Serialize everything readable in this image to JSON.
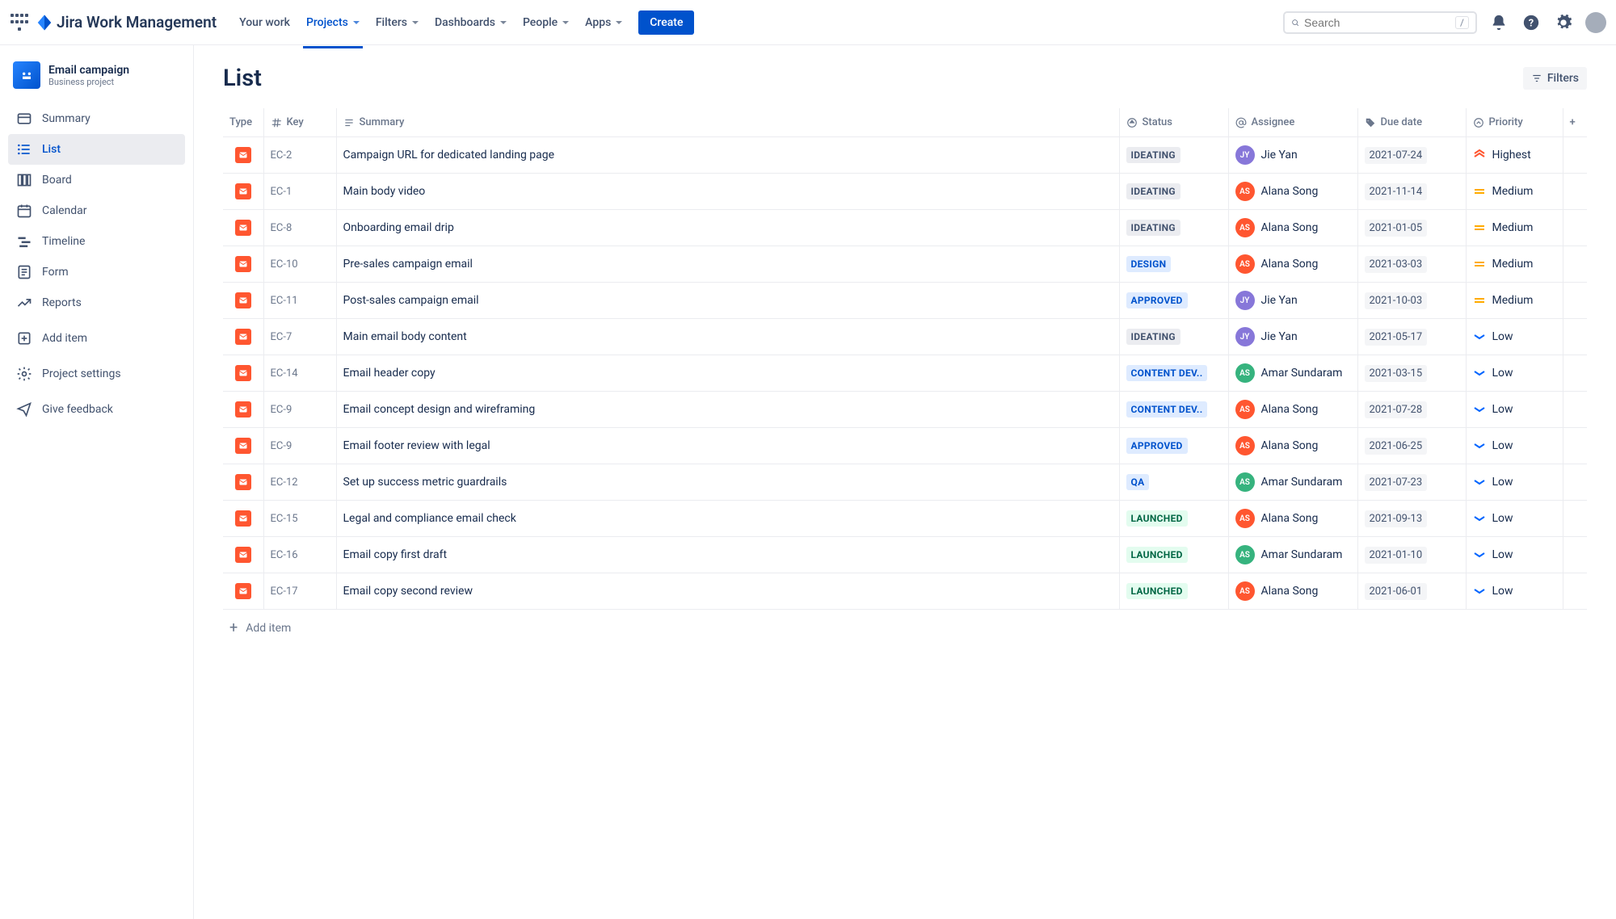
{
  "nav": {
    "product": "Jira Work Management",
    "items": [
      "Your work",
      "Projects",
      "Filters",
      "Dashboards",
      "People",
      "Apps"
    ],
    "active_index": 1,
    "create": "Create",
    "search_placeholder": "Search",
    "search_key": "/"
  },
  "sidebar": {
    "project_name": "Email campaign",
    "project_type": "Business project",
    "items": [
      {
        "icon": "summary",
        "label": "Summary"
      },
      {
        "icon": "list",
        "label": "List"
      },
      {
        "icon": "board",
        "label": "Board"
      },
      {
        "icon": "calendar",
        "label": "Calendar"
      },
      {
        "icon": "timeline",
        "label": "Timeline"
      },
      {
        "icon": "form",
        "label": "Form"
      },
      {
        "icon": "reports",
        "label": "Reports"
      },
      {
        "icon": "add",
        "label": "Add item"
      },
      {
        "icon": "settings",
        "label": "Project settings"
      },
      {
        "icon": "feedback",
        "label": "Give feedback"
      }
    ],
    "active_index": 1
  },
  "main": {
    "title": "List",
    "filters_label": "Filters",
    "add_item": "Add item",
    "columns": {
      "type": "Type",
      "key": "Key",
      "summary": "Summary",
      "status": "Status",
      "assignee": "Assignee",
      "due_date": "Due date",
      "priority": "Priority"
    },
    "rows": [
      {
        "key": "EC-2",
        "summary": "Campaign URL for dedicated landing page",
        "status": "IDEATING",
        "status_style": "gray",
        "assignee": "Jie Yan",
        "avatar_color": "#8777D9",
        "due": "2021-07-24",
        "priority": "Highest"
      },
      {
        "key": "EC-1",
        "summary": "Main body video",
        "status": "IDEATING",
        "status_style": "gray",
        "assignee": "Alana Song",
        "avatar_color": "#FF5630",
        "due": "2021-11-14",
        "priority": "Medium"
      },
      {
        "key": "EC-8",
        "summary": "Onboarding email drip",
        "status": "IDEATING",
        "status_style": "gray",
        "assignee": "Alana Song",
        "avatar_color": "#FF5630",
        "due": "2021-01-05",
        "priority": "Medium"
      },
      {
        "key": "EC-10",
        "summary": "Pre-sales campaign email",
        "status": "DESIGN",
        "status_style": "blue",
        "assignee": "Alana Song",
        "avatar_color": "#FF5630",
        "due": "2021-03-03",
        "priority": "Medium"
      },
      {
        "key": "EC-11",
        "summary": "Post-sales campaign email",
        "status": "APPROVED",
        "status_style": "blue",
        "assignee": "Jie Yan",
        "avatar_color": "#8777D9",
        "due": "2021-10-03",
        "priority": "Medium"
      },
      {
        "key": "EC-7",
        "summary": "Main email body content",
        "status": "IDEATING",
        "status_style": "gray",
        "assignee": "Jie Yan",
        "avatar_color": "#8777D9",
        "due": "2021-05-17",
        "priority": "Low"
      },
      {
        "key": "EC-14",
        "summary": "Email header copy",
        "status": "CONTENT DEV..",
        "status_style": "blue",
        "assignee": "Amar Sundaram",
        "avatar_color": "#36B37E",
        "due": "2021-03-15",
        "priority": "Low"
      },
      {
        "key": "EC-9",
        "summary": "Email concept design and wireframing",
        "status": "CONTENT DEV..",
        "status_style": "blue",
        "assignee": "Alana Song",
        "avatar_color": "#FF5630",
        "due": "2021-07-28",
        "priority": "Low"
      },
      {
        "key": "EC-9",
        "summary": "Email footer review with legal",
        "status": "APPROVED",
        "status_style": "blue",
        "assignee": "Alana Song",
        "avatar_color": "#FF5630",
        "due": "2021-06-25",
        "priority": "Low"
      },
      {
        "key": "EC-12",
        "summary": "Set up success metric guardrails",
        "status": "QA",
        "status_style": "blue",
        "assignee": "Amar Sundaram",
        "avatar_color": "#36B37E",
        "due": "2021-07-23",
        "priority": "Low"
      },
      {
        "key": "EC-15",
        "summary": "Legal and compliance email check",
        "status": "LAUNCHED",
        "status_style": "green",
        "assignee": "Alana Song",
        "avatar_color": "#FF5630",
        "due": "2021-09-13",
        "priority": "Low"
      },
      {
        "key": "EC-16",
        "summary": "Email copy first draft",
        "status": "LAUNCHED",
        "status_style": "green",
        "assignee": "Amar Sundaram",
        "avatar_color": "#36B37E",
        "due": "2021-01-10",
        "priority": "Low"
      },
      {
        "key": "EC-17",
        "summary": "Email copy second review",
        "status": "LAUNCHED",
        "status_style": "green",
        "assignee": "Alana Song",
        "avatar_color": "#FF5630",
        "due": "2021-06-01",
        "priority": "Low"
      }
    ]
  }
}
